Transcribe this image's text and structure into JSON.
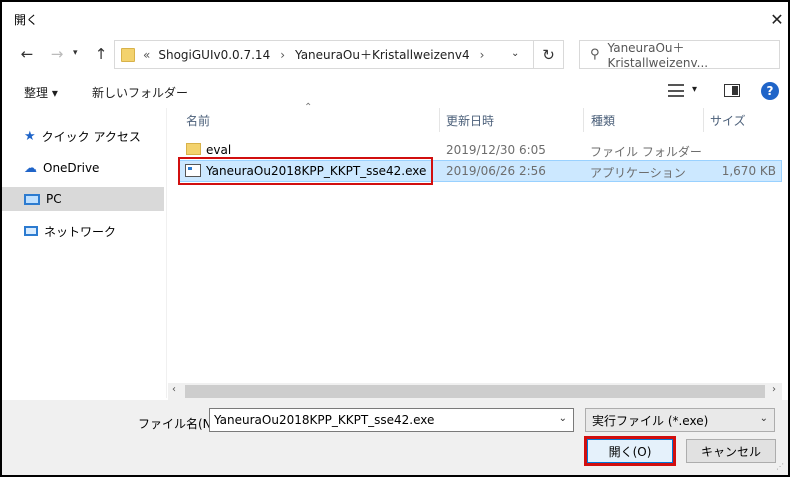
{
  "window": {
    "title": "開く",
    "close_icon": "close-icon"
  },
  "nav": {
    "back": "←",
    "forward": "→",
    "up": "↑"
  },
  "address": {
    "overflow": "«",
    "crumbs": [
      "ShogiGUIv0.0.7.14",
      "YaneuraOu＋Kristallweizenv4"
    ],
    "sep": "›"
  },
  "search": {
    "placeholder": "YaneuraOu＋Kristallweizenv..."
  },
  "toolbar": {
    "organize": "整理 ▾",
    "new_folder": "新しいフォルダー",
    "view_icon": "▾"
  },
  "sidebar": {
    "items": [
      {
        "label": "クイック アクセス",
        "icon": "star-icon"
      },
      {
        "label": "OneDrive",
        "icon": "cloud-icon"
      },
      {
        "label": "PC",
        "icon": "computer-icon"
      },
      {
        "label": "ネットワーク",
        "icon": "network-icon"
      }
    ]
  },
  "columns": {
    "name": "名前",
    "date": "更新日時",
    "type": "種類",
    "size": "サイズ"
  },
  "files": [
    {
      "name": "eval",
      "date": "2019/12/30 6:05",
      "type": "ファイル フォルダー",
      "size": "",
      "icon": "folder-icon"
    },
    {
      "name": "YaneuraOu2018KPP_KKPT_sse42.exe",
      "date": "2019/06/26 2:56",
      "type": "アプリケーション",
      "size": "1,670 KB",
      "icon": "exe-icon"
    }
  ],
  "footer": {
    "filename_label": "ファイル名(N):",
    "filename_value": "YaneuraOu2018KPP_KKPT_sse42.exe",
    "filetype": "実行ファイル (*.exe)",
    "open": "開く(O)",
    "cancel": "キャンセル"
  },
  "colors": {
    "accent": "#0078d7",
    "highlight": "#d10f0f",
    "selection": "#cce8ff"
  }
}
